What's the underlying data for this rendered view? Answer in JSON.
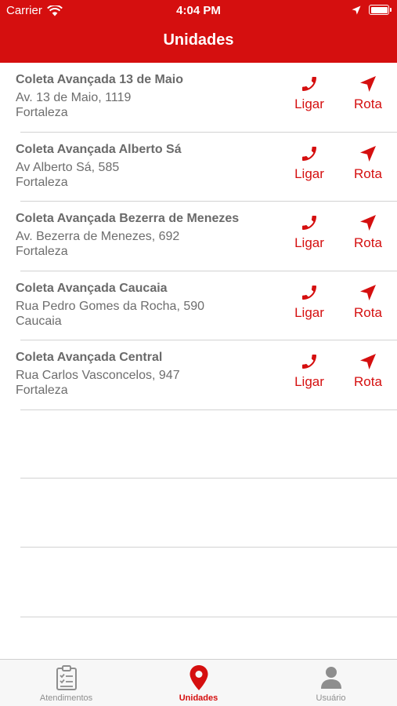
{
  "status_bar": {
    "carrier": "Carrier",
    "time": "4:04 PM"
  },
  "header": {
    "title": "Unidades"
  },
  "units": [
    {
      "name": "Coleta Avançada 13 de Maio",
      "address": "Av. 13 de Maio, 1119",
      "city": "Fortaleza",
      "call_label": "Ligar",
      "route_label": "Rota"
    },
    {
      "name": "Coleta Avançada Alberto Sá",
      "address": "Av Alberto Sá, 585",
      "city": "Fortaleza",
      "call_label": "Ligar",
      "route_label": "Rota"
    },
    {
      "name": "Coleta Avançada Bezerra de Menezes",
      "address": "Av. Bezerra de Menezes, 692",
      "city": "Fortaleza",
      "call_label": "Ligar",
      "route_label": "Rota"
    },
    {
      "name": "Coleta Avançada Caucaia",
      "address": "Rua Pedro Gomes da Rocha, 590",
      "city": "Caucaia",
      "call_label": "Ligar",
      "route_label": "Rota"
    },
    {
      "name": "Coleta Avançada Central",
      "address": "Rua Carlos Vasconcelos, 947",
      "city": "Fortaleza",
      "call_label": "Ligar",
      "route_label": "Rota"
    }
  ],
  "tabbar": {
    "tabs": [
      {
        "label": "Atendimentos",
        "icon": "clipboard-icon"
      },
      {
        "label": "Unidades",
        "icon": "map-pin-icon",
        "active": true
      },
      {
        "label": "Usuário",
        "icon": "user-icon"
      }
    ]
  },
  "colors": {
    "accent": "#d50f0f",
    "text_gray": "#6d6d6d",
    "tab_inactive": "#8e8e8e"
  }
}
